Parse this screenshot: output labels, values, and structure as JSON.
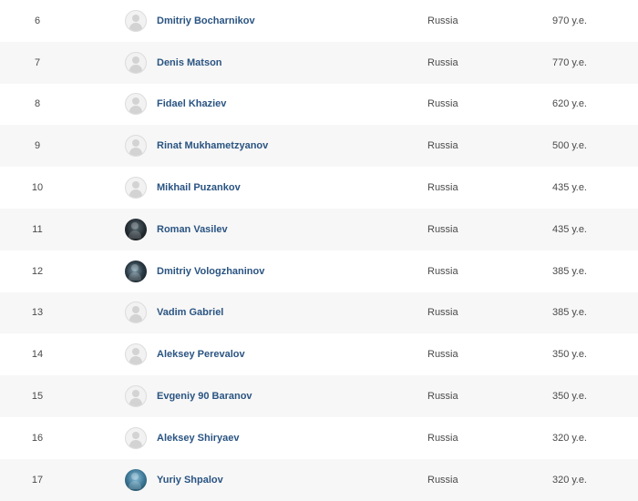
{
  "rows": [
    {
      "rank": "6",
      "name": "Dmitriy Bocharnikov",
      "country": "Russia",
      "amount": "970 у.е.",
      "avatar": "default-avatar-icon"
    },
    {
      "rank": "7",
      "name": "Denis Matson",
      "country": "Russia",
      "amount": "770 у.е.",
      "avatar": "default-avatar-icon"
    },
    {
      "rank": "8",
      "name": "Fidael Khaziev",
      "country": "Russia",
      "amount": "620 у.е.",
      "avatar": "default-avatar-icon"
    },
    {
      "rank": "9",
      "name": "Rinat Mukhametzyanov",
      "country": "Russia",
      "amount": "500 у.е.",
      "avatar": "default-avatar-icon"
    },
    {
      "rank": "10",
      "name": "Mikhail Puzankov",
      "country": "Russia",
      "amount": "435 у.е.",
      "avatar": "default-avatar-icon"
    },
    {
      "rank": "11",
      "name": "Roman Vasilev",
      "country": "Russia",
      "amount": "435 у.е.",
      "avatar": "user-photo"
    },
    {
      "rank": "12",
      "name": "Dmitriy Vologzhaninov",
      "country": "Russia",
      "amount": "385 у.е.",
      "avatar": "user-photo"
    },
    {
      "rank": "13",
      "name": "Vadim Gabriel",
      "country": "Russia",
      "amount": "385 у.е.",
      "avatar": "default-avatar-icon"
    },
    {
      "rank": "14",
      "name": "Aleksey Perevalov",
      "country": "Russia",
      "amount": "350 у.е.",
      "avatar": "default-avatar-icon"
    },
    {
      "rank": "15",
      "name": "Evgeniy 90 Baranov",
      "country": "Russia",
      "amount": "350 у.е.",
      "avatar": "default-avatar-icon"
    },
    {
      "rank": "16",
      "name": "Aleksey Shiryaev",
      "country": "Russia",
      "amount": "320 у.е.",
      "avatar": "default-avatar-icon"
    },
    {
      "rank": "17",
      "name": "Yuriy Shpalov",
      "country": "Russia",
      "amount": "320 у.е.",
      "avatar": "user-photo"
    }
  ],
  "colors": {
    "name_link": "#2a5482",
    "row_alt_bg": "#f7f7f7",
    "text": "#4a4a4a"
  }
}
